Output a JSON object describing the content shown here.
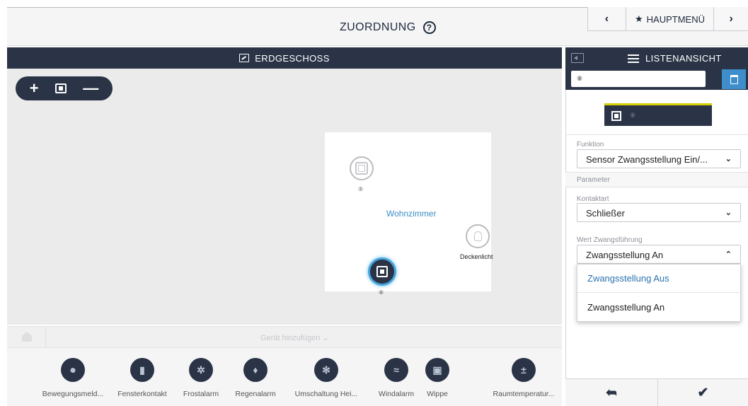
{
  "header": {
    "title": "ZUORDNUNG",
    "help_icon": "question-circle-icon",
    "prev_label": "‹",
    "main_menu_label": "HAUPTMENÜ",
    "next_label": "›"
  },
  "floor": {
    "title": "ERDGESCHOSS",
    "zoom_in_label": "+",
    "zoom_out_label": "—",
    "room": {
      "name": "Wohnzimmer",
      "devices": [
        {
          "badge": "⑤",
          "label": ""
        },
        {
          "badge": "",
          "label": "Deckenlicht"
        },
        {
          "badge": "⑧",
          "label": ""
        }
      ]
    },
    "add_device_label": "Gerät hinzufügen ⌄"
  },
  "palette": {
    "items": [
      {
        "label": "Bewegungsmeld...",
        "icon": "motion-sensor-icon",
        "glyph": "⏺"
      },
      {
        "label": "Fensterkontakt",
        "icon": "window-contact-icon",
        "glyph": "▮"
      },
      {
        "label": "Frostalarm",
        "icon": "frost-icon",
        "glyph": "✲"
      },
      {
        "label": "Regenalarm",
        "icon": "rain-drop-icon",
        "glyph": "♦"
      },
      {
        "label": "Umschaltung Hei...",
        "icon": "heating-switch-icon",
        "glyph": "✻"
      },
      {
        "label": "Windalarm",
        "icon": "wind-icon",
        "glyph": "≈"
      },
      {
        "label": "Wippe",
        "icon": "rocker-switch-icon",
        "glyph": "▣"
      },
      {
        "label": "Raumtemperatur...",
        "icon": "thermostat-icon",
        "glyph": "±"
      }
    ]
  },
  "panel": {
    "title": "LISTENANSICHT",
    "search_value": "⑧",
    "device_tile_badge": "⑧",
    "funktion_label": "Funktion",
    "funktion_value": "Sensor Zwangsstellung Ein/...",
    "parameter_label": "Parameter",
    "kontaktart_label": "Kontaktart",
    "kontaktart_value": "Schließer",
    "wert_label": "Wert Zwangsführung",
    "wert_value": "Zwangsstellung An",
    "options": [
      "Zwangsstellung Aus",
      "Zwangsstellung An"
    ],
    "back_icon": "reply-arrow-icon",
    "confirm_icon": "checkmark-icon"
  },
  "colors": {
    "dark_navy": "#2a3446",
    "accent_blue": "#3e8ecb",
    "highlight_yellow": "#d4d000"
  }
}
